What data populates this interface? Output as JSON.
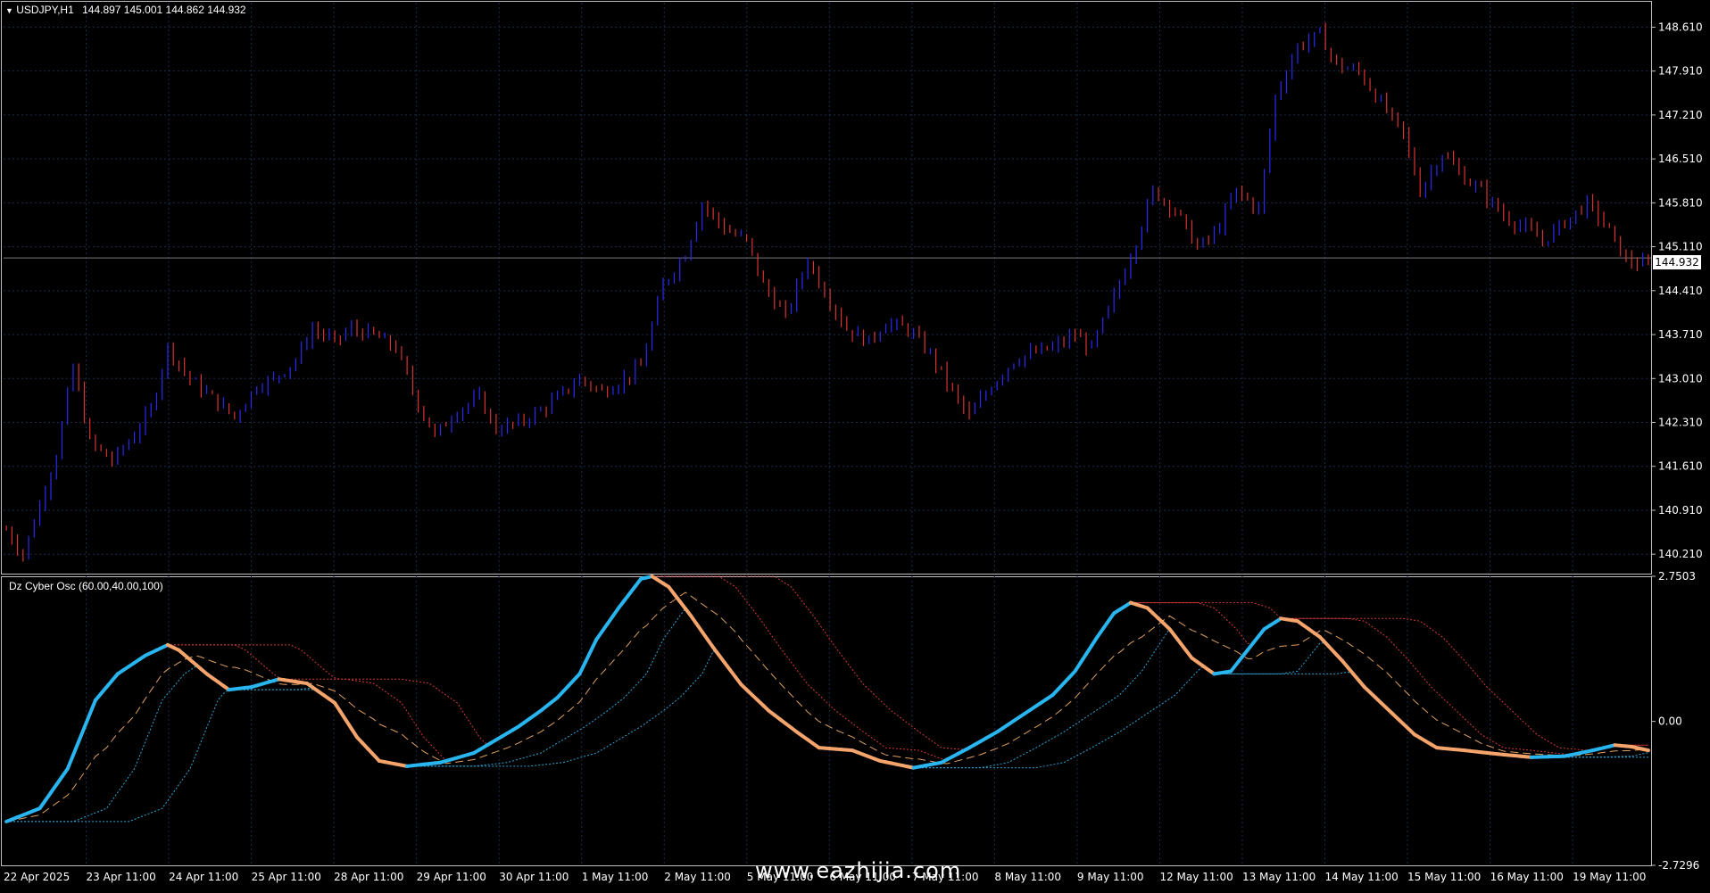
{
  "main_pane": {
    "label_symbol": "USDJPY,H1",
    "label_ohlc": "144.897 145.001 144.862 144.932",
    "current_price": "144.932",
    "colors": {
      "bull": "#2a2af0",
      "bear": "#d83232",
      "grid": "#1c2a4a",
      "border": "#bfbfbf",
      "background": "#000000"
    }
  },
  "osc_pane": {
    "label": "Dz Cyber Osc (60.00,40.00,100)",
    "colors": {
      "rising": "#29b6f0",
      "falling": "#f5a56b",
      "red_band": "#d43a3a",
      "blue_band": "#2fa6d8",
      "signal": "#e0a060"
    }
  },
  "watermark": "www.eazhijia.com",
  "chart_data": [
    {
      "type": "candlestick",
      "symbol": "USDJPY",
      "timeframe": "H1",
      "ylim": [
        139.9,
        149.0
      ],
      "y_ticks": [
        "148.610",
        "147.910",
        "147.210",
        "146.510",
        "145.810",
        "145.110",
        "144.410",
        "143.710",
        "143.010",
        "142.310",
        "141.610",
        "140.910",
        "140.210"
      ],
      "x_ticks": [
        "22 Apr 2025",
        "23 Apr 11:00",
        "24 Apr 11:00",
        "25 Apr 11:00",
        "28 Apr 11:00",
        "29 Apr 11:00",
        "30 Apr 11:00",
        "1 May 11:00",
        "2 May 11:00",
        "5 May 11:00",
        "6 May 11:00",
        "7 May 11:00",
        "8 May 11:00",
        "9 May 11:00",
        "12 May 11:00",
        "13 May 11:00",
        "14 May 11:00",
        "15 May 11:00",
        "16 May 11:00",
        "19 May 11:00"
      ],
      "close_path": [
        [
          0,
          140.6
        ],
        [
          3,
          140.2
        ],
        [
          6,
          141.0
        ],
        [
          9,
          141.8
        ],
        [
          12,
          143.2
        ],
        [
          15,
          142.0
        ],
        [
          19,
          141.7
        ],
        [
          22,
          142.0
        ],
        [
          26,
          142.5
        ],
        [
          29,
          143.5
        ],
        [
          33,
          143.0
        ],
        [
          37,
          142.7
        ],
        [
          41,
          142.4
        ],
        [
          45,
          142.9
        ],
        [
          48,
          143.0
        ],
        [
          52,
          143.3
        ],
        [
          55,
          143.8
        ],
        [
          59,
          143.6
        ],
        [
          62,
          143.8
        ],
        [
          66,
          143.7
        ],
        [
          70,
          143.5
        ],
        [
          74,
          142.6
        ],
        [
          77,
          142.1
        ],
        [
          81,
          142.5
        ],
        [
          85,
          142.7
        ],
        [
          88,
          142.2
        ],
        [
          92,
          142.3
        ],
        [
          96,
          142.5
        ],
        [
          99,
          142.7
        ],
        [
          103,
          143.0
        ],
        [
          107,
          142.8
        ],
        [
          111,
          143.0
        ],
        [
          114,
          143.2
        ],
        [
          118,
          144.5
        ],
        [
          122,
          145.0
        ],
        [
          125,
          145.8
        ],
        [
          129,
          145.4
        ],
        [
          133,
          145.2
        ],
        [
          136,
          144.5
        ],
        [
          140,
          144.0
        ],
        [
          144,
          144.9
        ],
        [
          147,
          144.4
        ],
        [
          151,
          143.8
        ],
        [
          155,
          143.6
        ],
        [
          158,
          143.9
        ],
        [
          162,
          143.8
        ],
        [
          166,
          143.4
        ],
        [
          170,
          142.8
        ],
        [
          173,
          142.4
        ],
        [
          177,
          142.9
        ],
        [
          181,
          143.3
        ],
        [
          184,
          143.4
        ],
        [
          188,
          143.5
        ],
        [
          192,
          143.7
        ],
        [
          195,
          143.5
        ],
        [
          199,
          144.3
        ],
        [
          203,
          145.2
        ],
        [
          206,
          146.0
        ],
        [
          210,
          145.7
        ],
        [
          214,
          145.1
        ],
        [
          217,
          145.3
        ],
        [
          221,
          146.0
        ],
        [
          225,
          145.7
        ],
        [
          228,
          147.5
        ],
        [
          232,
          148.3
        ],
        [
          236,
          148.5
        ],
        [
          239,
          148.0
        ],
        [
          243,
          147.9
        ],
        [
          247,
          147.4
        ],
        [
          251,
          146.9
        ],
        [
          254,
          146.0
        ],
        [
          258,
          146.6
        ],
        [
          262,
          146.2
        ],
        [
          265,
          146.0
        ],
        [
          269,
          145.6
        ],
        [
          273,
          145.4
        ],
        [
          276,
          145.2
        ],
        [
          280,
          145.5
        ],
        [
          284,
          145.8
        ],
        [
          287,
          145.5
        ],
        [
          291,
          144.9
        ],
        [
          295,
          144.8
        ]
      ],
      "n_bars": 296
    },
    {
      "type": "line",
      "title": "Dz Cyber Osc (60.00,40.00,100)",
      "ylim": [
        -2.7296,
        2.7503
      ],
      "y_ticks": [
        "2.7503",
        "0.00",
        "-2.7296"
      ],
      "series": [
        {
          "values": [
            [
              0,
              -1.9
            ],
            [
              6,
              -1.65
            ],
            [
              11,
              -0.9
            ],
            [
              16,
              0.4
            ],
            [
              20,
              0.9
            ],
            [
              25,
              1.25
            ],
            [
              29,
              1.45
            ],
            [
              31,
              1.35
            ],
            [
              36,
              0.9
            ],
            [
              40,
              0.6
            ],
            [
              44,
              0.65
            ],
            [
              49,
              0.8
            ],
            [
              54,
              0.72
            ],
            [
              59,
              0.35
            ],
            [
              63,
              -0.3
            ],
            [
              67,
              -0.75
            ],
            [
              72,
              -0.85
            ],
            [
              78,
              -0.78
            ],
            [
              84,
              -0.6
            ],
            [
              88,
              -0.35
            ],
            [
              92,
              -0.1
            ],
            [
              96,
              0.2
            ],
            [
              99,
              0.45
            ],
            [
              103,
              0.9
            ],
            [
              106,
              1.55
            ],
            [
              110,
              2.15
            ],
            [
              114,
              2.7
            ],
            [
              116,
              2.75
            ],
            [
              119,
              2.55
            ],
            [
              123,
              2.0
            ],
            [
              127,
              1.4
            ],
            [
              132,
              0.7
            ],
            [
              137,
              0.2
            ],
            [
              142,
              -0.2
            ],
            [
              146,
              -0.5
            ],
            [
              152,
              -0.55
            ],
            [
              157,
              -0.75
            ],
            [
              163,
              -0.88
            ],
            [
              168,
              -0.78
            ],
            [
              173,
              -0.5
            ],
            [
              178,
              -0.2
            ],
            [
              183,
              0.15
            ],
            [
              188,
              0.5
            ],
            [
              192,
              0.95
            ],
            [
              196,
              1.6
            ],
            [
              199,
              2.05
            ],
            [
              202,
              2.25
            ],
            [
              205,
              2.15
            ],
            [
              209,
              1.75
            ],
            [
              213,
              1.2
            ],
            [
              217,
              0.9
            ],
            [
              220,
              0.95
            ],
            [
              223,
              1.35
            ],
            [
              226,
              1.75
            ],
            [
              229,
              1.95
            ],
            [
              232,
              1.9
            ],
            [
              236,
              1.6
            ],
            [
              240,
              1.15
            ],
            [
              244,
              0.65
            ],
            [
              249,
              0.15
            ],
            [
              253,
              -0.25
            ],
            [
              257,
              -0.5
            ],
            [
              262,
              -0.55
            ],
            [
              268,
              -0.62
            ],
            [
              274,
              -0.68
            ],
            [
              280,
              -0.66
            ],
            [
              285,
              -0.55
            ],
            [
              289,
              -0.45
            ],
            [
              292,
              -0.48
            ],
            [
              295,
              -0.55
            ]
          ]
        },
        {
          "band": "red_outer"
        },
        {
          "band": "red_inner"
        },
        {
          "band": "signal"
        },
        {
          "band": "blue_inner"
        },
        {
          "band": "blue_outer"
        }
      ]
    }
  ]
}
